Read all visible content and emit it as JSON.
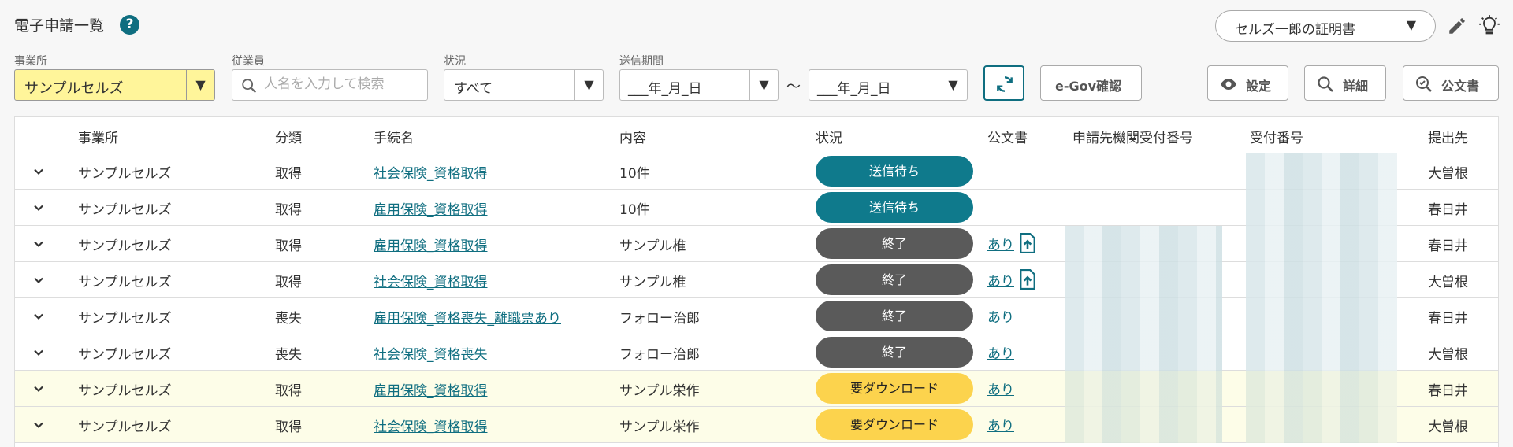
{
  "header": {
    "title": "電子申請一覧",
    "help_icon": "?",
    "certificate_select": "セルズ一郎の証明書",
    "dropdown_glyph": "▼",
    "icons": [
      "pencil-icon",
      "lightbulb-icon",
      "help-icon"
    ]
  },
  "filters": {
    "office_label": "事業所",
    "office_value": "サンプルセルズ",
    "employee_label": "従業員",
    "employee_placeholder": "人名を入力して検索",
    "status_label": "状況",
    "status_value": "すべて",
    "period_label": "送信期間",
    "date_from": "___年_月_日",
    "date_to": "___年_月_日",
    "tilde": "～",
    "egov_button": "e-Gov確認",
    "settings_button": "設定",
    "detail_button": "詳細",
    "official_doc_button": "公文書"
  },
  "table": {
    "columns": [
      "事業所",
      "分類",
      "手続名",
      "内容",
      "状況",
      "公文書",
      "申請先機関受付番号",
      "受付番号",
      "提出先"
    ],
    "rows": [
      {
        "office": "サンプルセルズ",
        "category": "取得",
        "procedure": "社会保険_資格取得",
        "content": "10件",
        "status": "送信待ち",
        "status_type": "blue",
        "doc": "",
        "upload": false,
        "dest": "大曽根",
        "highlight": false
      },
      {
        "office": "サンプルセルズ",
        "category": "取得",
        "procedure": "雇用保険_資格取得",
        "content": "10件",
        "status": "送信待ち",
        "status_type": "blue",
        "doc": "",
        "upload": false,
        "dest": "春日井",
        "highlight": false
      },
      {
        "office": "サンプルセルズ",
        "category": "取得",
        "procedure": "雇用保険_資格取得",
        "content": "サンプル椎",
        "status": "終了",
        "status_type": "gray",
        "doc": "あり",
        "upload": true,
        "dest": "春日井",
        "highlight": false
      },
      {
        "office": "サンプルセルズ",
        "category": "取得",
        "procedure": "社会保険_資格取得",
        "content": "サンプル椎",
        "status": "終了",
        "status_type": "gray",
        "doc": "あり",
        "upload": true,
        "dest": "大曽根",
        "highlight": false
      },
      {
        "office": "サンプルセルズ",
        "category": "喪失",
        "procedure": "雇用保険_資格喪失_離職票あり",
        "content": "フォロー治郎",
        "status": "終了",
        "status_type": "gray",
        "doc": "あり",
        "upload": false,
        "dest": "春日井",
        "highlight": false
      },
      {
        "office": "サンプルセルズ",
        "category": "喪失",
        "procedure": "社会保険_資格喪失",
        "content": "フォロー治郎",
        "status": "終了",
        "status_type": "gray",
        "doc": "あり",
        "upload": false,
        "dest": "大曽根",
        "highlight": false
      },
      {
        "office": "サンプルセルズ",
        "category": "取得",
        "procedure": "雇用保険_資格取得",
        "content": "サンプル栄作",
        "status": "要ダウンロード",
        "status_type": "yellow",
        "doc": "あり",
        "upload": false,
        "dest": "春日井",
        "highlight": true
      },
      {
        "office": "サンプルセルズ",
        "category": "取得",
        "procedure": "社会保険_資格取得",
        "content": "サンプル栄作",
        "status": "要ダウンロード",
        "status_type": "yellow",
        "doc": "あり",
        "upload": false,
        "dest": "大曽根",
        "highlight": true
      }
    ]
  },
  "colors": {
    "accent": "#0f6e80",
    "status_blue": "#0f7a8c",
    "status_gray": "#5a5a5a",
    "status_yellow": "#fcd34d",
    "office_highlight": "#fff59a"
  }
}
